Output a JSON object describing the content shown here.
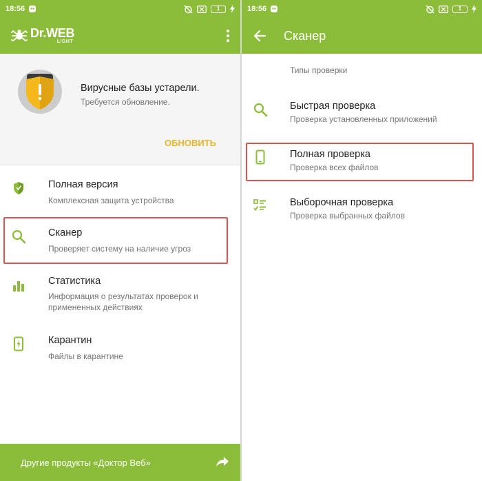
{
  "left": {
    "statusbar": {
      "time": "18:56",
      "battery": "1"
    },
    "appbar": {
      "logo_main": "Dr.WEB",
      "logo_sub": "LIGHT"
    },
    "alert": {
      "title": "Вирусные базы устарели.",
      "subtitle": "Требуется обновление.",
      "button": "ОБНОВИТЬ"
    },
    "menu": [
      {
        "title": "Полная версия",
        "subtitle": "Комплексная защита устройства",
        "icon": "shield-icon"
      },
      {
        "title": "Сканер",
        "subtitle": "Проверяет систему на наличие угроз",
        "icon": "search-icon"
      },
      {
        "title": "Статистика",
        "subtitle": "Информация о результатах проверок и примененных действиях",
        "icon": "bar-chart-icon"
      },
      {
        "title": "Карантин",
        "subtitle": "Файлы в карантине",
        "icon": "quarantine-icon"
      }
    ],
    "footer": {
      "label": "Другие продукты «Доктор Веб»"
    }
  },
  "right": {
    "statusbar": {
      "time": "18:56",
      "battery": "1"
    },
    "appbar": {
      "title": "Сканер"
    },
    "section_label": "Типы проверки",
    "items": [
      {
        "title": "Быстрая проверка",
        "subtitle": "Проверка установленных приложений",
        "icon": "search-icon"
      },
      {
        "title": "Полная проверка",
        "subtitle": "Проверка всех файлов",
        "icon": "phone-icon"
      },
      {
        "title": "Выборочная проверка",
        "subtitle": "Проверка выбранных файлов",
        "icon": "checklist-icon"
      }
    ]
  },
  "colors": {
    "accent": "#8bbd3a",
    "warning": "#e5b52a",
    "highlight": "#d9534f"
  }
}
